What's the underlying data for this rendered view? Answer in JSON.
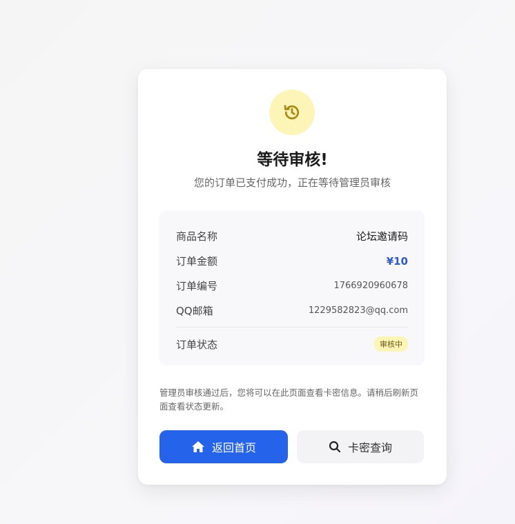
{
  "status": {
    "icon": "history-icon",
    "title": "等待审核!",
    "subtitle": "您的订单已支付成功，正在等待管理员审核"
  },
  "order": {
    "product_label": "商品名称",
    "product_value": "论坛邀请码",
    "amount_label": "订单金额",
    "amount_value": "¥10",
    "order_no_label": "订单编号",
    "order_no_value": "1766920960678",
    "email_label": "QQ邮箱",
    "email_value": "1229582823@qq.com",
    "status_label": "订单状态",
    "status_value": "审核中"
  },
  "notice": "管理员审核通过后，您将可以在此页面查看卡密信息。请稍后刷新页面查看状态更新。",
  "buttons": {
    "home_label": "返回首页",
    "home_icon": "home-icon",
    "query_label": "卡密查询",
    "query_icon": "search-icon"
  },
  "colors": {
    "primary": "#2563eb",
    "price": "#2f5bc9",
    "pending_bg": "#fdf4b7",
    "pending_icon": "#a98a16"
  }
}
